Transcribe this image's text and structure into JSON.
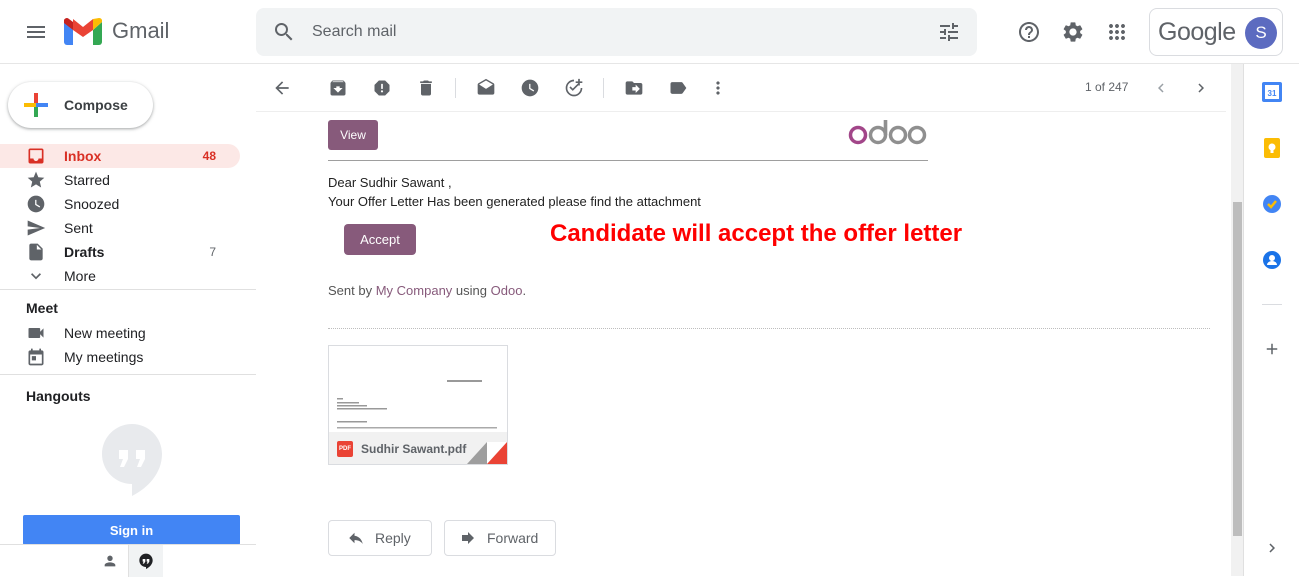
{
  "app": {
    "name": "Gmail"
  },
  "search": {
    "placeholder": "Search mail"
  },
  "account": {
    "brand": "Google",
    "avatar_letter": "S"
  },
  "sidebar": {
    "compose_label": "Compose",
    "items": [
      {
        "label": "Inbox",
        "count": "48",
        "icon": "inbox-icon"
      },
      {
        "label": "Starred",
        "count": "",
        "icon": "star-icon"
      },
      {
        "label": "Snoozed",
        "count": "",
        "icon": "clock-icon"
      },
      {
        "label": "Sent",
        "count": "",
        "icon": "send-icon"
      },
      {
        "label": "Drafts",
        "count": "7",
        "icon": "draft-icon"
      },
      {
        "label": "More",
        "count": "",
        "icon": "chevron-down-icon"
      }
    ],
    "meet": {
      "title": "Meet",
      "new_meeting": "New meeting",
      "my_meetings": "My meetings"
    },
    "hangouts": {
      "title": "Hangouts",
      "signin_label": "Sign in"
    }
  },
  "toolbar": {
    "pager": "1 of 247"
  },
  "email": {
    "view_label": "View",
    "brand_logo": "odoo",
    "greeting": "Dear Sudhir Sawant ,",
    "message": "Your Offer Letter Has been generated please find the attachment",
    "accept_label": "Accept",
    "annotation": "Candidate will accept the offer letter",
    "sent_by_prefix": "Sent by",
    "company": "My Company",
    "using": "using",
    "odoo_link": "Odoo",
    "period": ".",
    "attachment": {
      "filename": "Sudhir Sawant.pdf",
      "badge": "PDF"
    },
    "reply_label": "Reply",
    "forward_label": "Forward"
  },
  "colors": {
    "odoo_purple": "#875a7b",
    "gmail_red": "#d93025",
    "annotation_red": "#ff0000",
    "google_blue": "#4285f4"
  }
}
